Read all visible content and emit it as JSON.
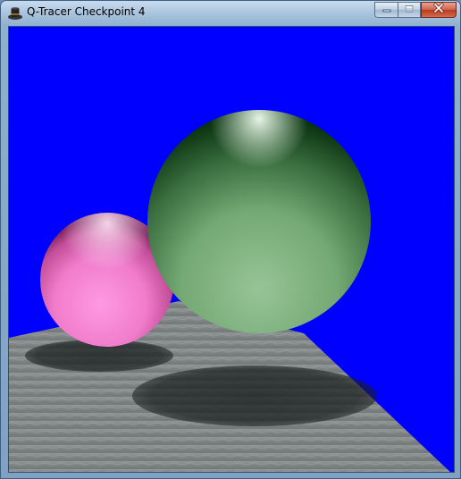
{
  "window": {
    "title": "Q-Tracer Checkpoint 4"
  },
  "caption_buttons": {
    "minimize_icon": "minimize-icon",
    "maximize_icon": "maximize-icon",
    "close_icon": "close-icon"
  },
  "scene": {
    "background_color": "#0000ff",
    "floor_color": "#8a8f90",
    "pink_sphere_color": "#ff88d8",
    "green_sphere_color": "#8fbf8f"
  }
}
